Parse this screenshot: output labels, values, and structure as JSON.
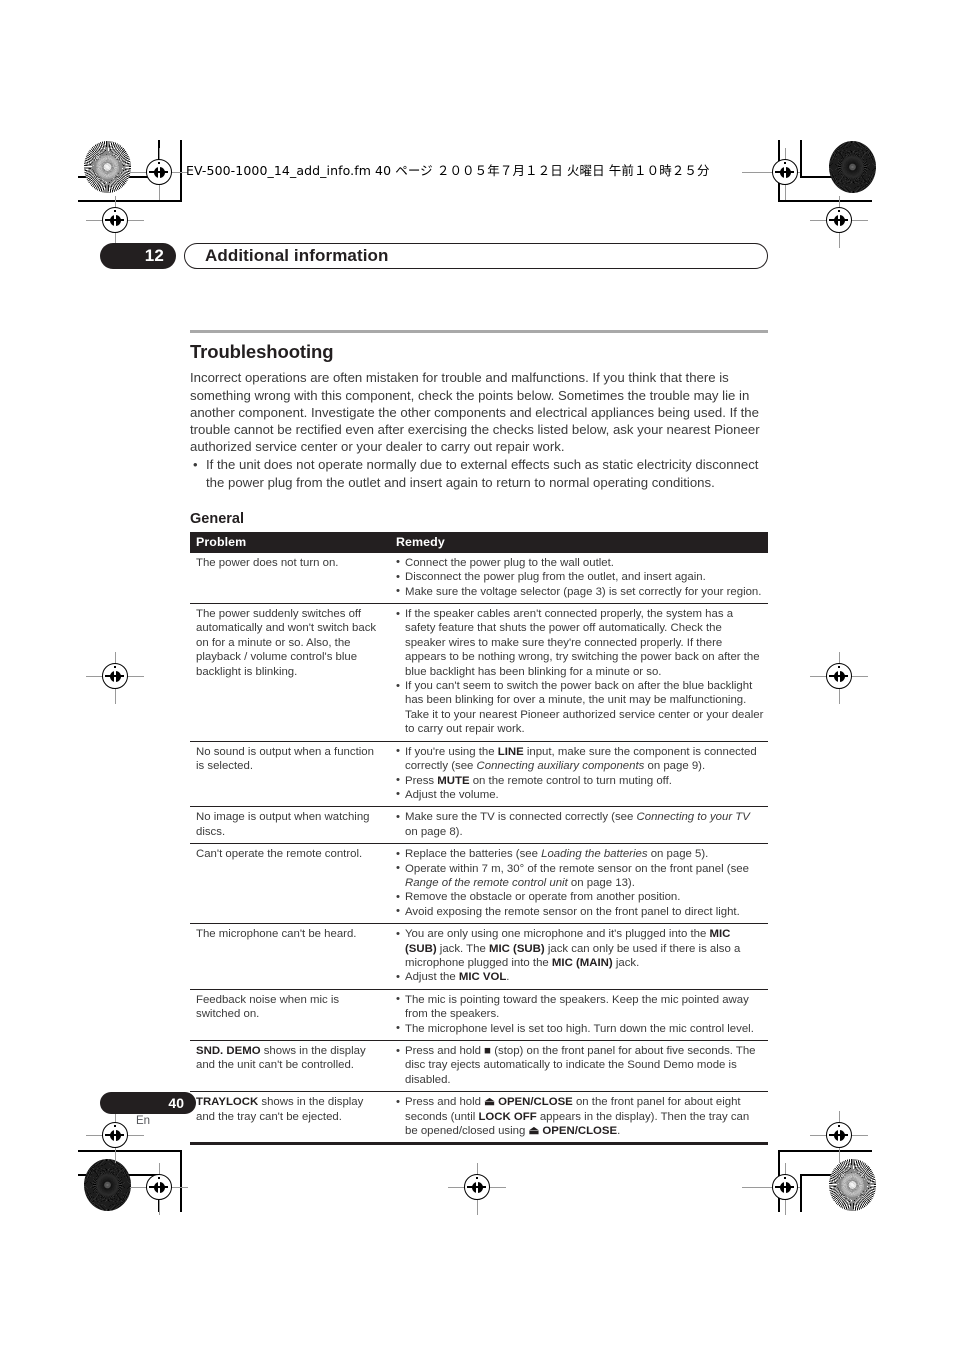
{
  "print_header": {
    "filename_line": "EV-500-1000_14_add_info.fm  40 ページ  ２００５年７月１２日  火曜日  午前１０時２５分"
  },
  "chapter": {
    "number": "12",
    "title": "Additional information"
  },
  "section": {
    "title": "Troubleshooting",
    "intro": "Incorrect operations are often mistaken for trouble and malfunctions. If you think that there is something wrong with this component, check the points below. Sometimes the trouble may lie in another component. Investigate the other components and electrical appliances being used. If the trouble cannot be rectified even after exercising the checks listed below, ask your nearest Pioneer authorized service center or your dealer to carry out repair work.",
    "bullets": [
      "If the unit does not operate normally due to external effects such as static electricity disconnect the power plug from the outlet and insert again to return to normal operating conditions."
    ],
    "subsection_title": "General"
  },
  "table": {
    "headers": {
      "problem": "Problem",
      "remedy": "Remedy"
    },
    "rows": [
      {
        "problem": "The power does not turn on.",
        "remedies": [
          "Connect the power plug to the wall outlet.",
          "Disconnect the power plug from the outlet, and insert again.",
          "Make sure the voltage selector (page 3) is set correctly for your region."
        ]
      },
      {
        "problem": "The power suddenly switches off automatically and won't switch back on for a minute or so. Also, the playback / volume control's blue backlight is blinking.",
        "remedies": [
          "If the speaker cables aren't connected properly, the system has a safety feature that shuts the power off automatically. Check the speaker wires to make sure they're connected properly. If there appears to be nothing wrong, try switching the power back on after the blue backlight has been blinking for a minute or so.",
          "If you can't seem to switch the power back on after the blue backlight has been blinking for over a minute, the unit may be malfunctioning. Take it to your nearest Pioneer authorized service center or your dealer to carry out repair work."
        ]
      },
      {
        "problem": "No sound is output when a function is selected.",
        "remedies_html": [
          "If you're using the <b>LINE</b> input, make sure the component is connected correctly (see <i>Connecting auxiliary components</i> on page 9).",
          "Press <b>MUTE</b> on the remote control to turn muting off.",
          "Adjust the volume."
        ]
      },
      {
        "problem": "No image is output when watching discs.",
        "remedies_html": [
          "Make sure the TV is connected correctly (see <i>Connecting to your TV</i> on page 8)."
        ]
      },
      {
        "problem": "Can't operate the remote control.",
        "remedies_html": [
          "Replace the batteries (see <i>Loading the batteries</i> on page 5).",
          "Operate within 7 m, 30&deg; of the remote sensor on the front panel (see <i>Range of the remote control unit</i> on page 13).",
          "Remove the obstacle or operate from another position.",
          "Avoid exposing the remote sensor on the front panel to direct light."
        ]
      },
      {
        "problem": "The microphone can't be heard.",
        "remedies_html": [
          "You are only using one microphone and it's plugged into the <b>MIC (SUB)</b> jack. The <b>MIC (SUB)</b> jack can only be used if there is also a microphone plugged into the <b>MIC (MAIN)</b> jack.",
          "Adjust the <b>MIC VOL</b>."
        ]
      },
      {
        "problem": "Feedback noise when mic is switched on.",
        "remedies": [
          "The mic is pointing toward the speakers. Keep the mic pointed away from the speakers.",
          "The microphone level is set too high. Turn down the mic control level."
        ]
      },
      {
        "problem_html": "<b>SND. DEMO</b> shows in the display and the unit can't be controlled.",
        "remedies_html": [
          "Press and hold <b>■</b> (stop) on the front panel for about five seconds. The disc tray ejects automatically to indicate the Sound Demo mode is disabled."
        ]
      },
      {
        "problem_html": "<b>TRAYLOCK</b> shows in the display and the tray can't be ejected.",
        "remedies_html": [
          "Press and hold <b>⏏ OPEN/CLOSE</b> on the front panel for about eight seconds (until <b>LOCK OFF</b> appears in the display). Then the tray can be opened/closed using <b>⏏ OPEN/CLOSE</b>."
        ]
      }
    ]
  },
  "footer": {
    "page_number": "40",
    "language_code": "En"
  },
  "colors": {
    "ink_black": "#231f20",
    "body_gray": "#3b3b3b",
    "rule_gray": "#a9a9a9"
  }
}
